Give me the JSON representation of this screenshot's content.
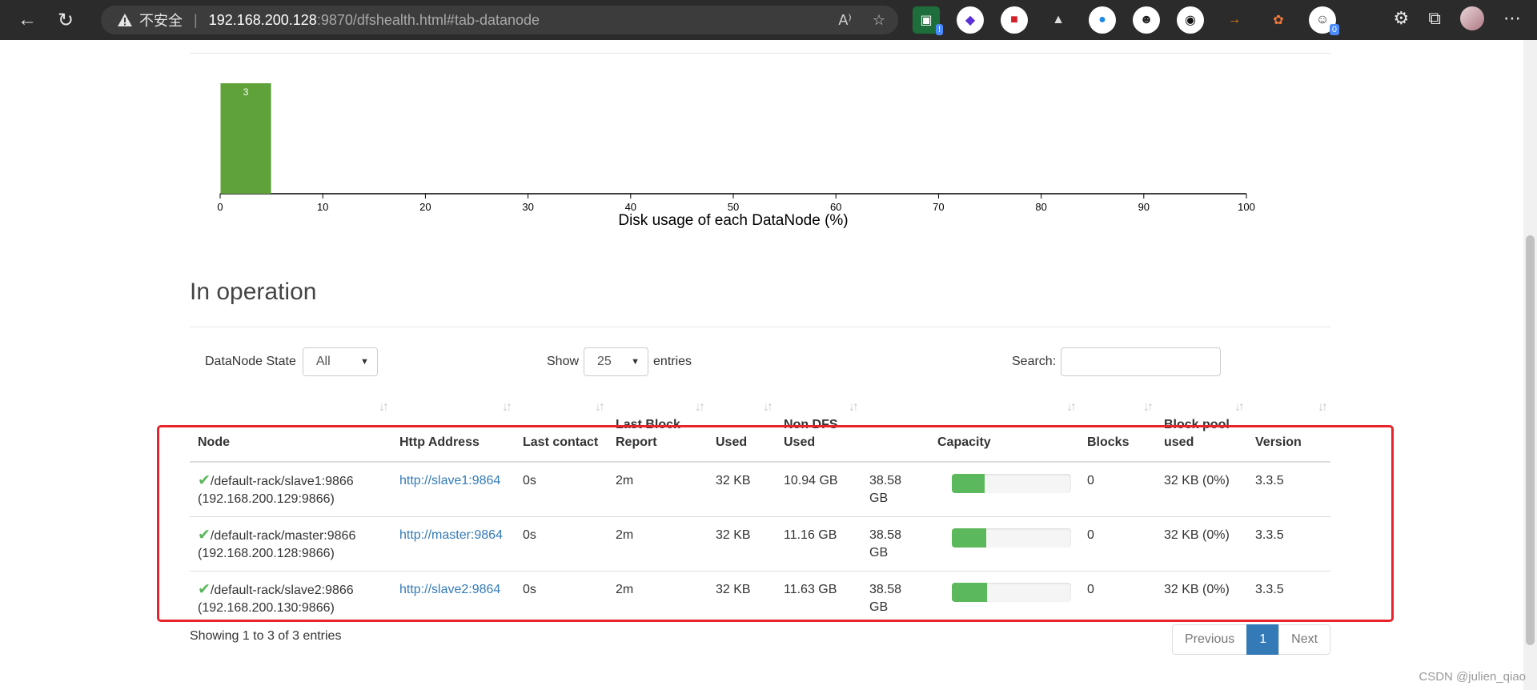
{
  "browser": {
    "insecure_label": "不安全",
    "url_host": "192.168.200.128",
    "url_rest": ":9870/dfshealth.html#tab-datanode",
    "ext_badges": [
      "!",
      "0"
    ]
  },
  "chart_data": {
    "type": "bar",
    "title": "",
    "xlabel": "Disk usage of each DataNode (%)",
    "ylabel": "",
    "bins": [
      {
        "x0": 0,
        "x1": 5,
        "count": 3
      }
    ],
    "xlim": [
      0,
      100
    ],
    "xticks": [
      "0",
      "10",
      "20",
      "30",
      "40",
      "50",
      "60",
      "70",
      "80",
      "90",
      "100"
    ],
    "bar_color": "#5fa23a"
  },
  "section": {
    "title": "In operation"
  },
  "controls": {
    "state_label": "DataNode State",
    "state_value": "All",
    "show_label": "Show",
    "length_value": "25",
    "entries_label": "entries",
    "search_label": "Search:",
    "search_value": ""
  },
  "table": {
    "headers": {
      "node": "Node",
      "http": "Http Address",
      "last_contact": "Last contact",
      "last_block_report": "Last Block Report",
      "used": "Used",
      "non_dfs": "Non DFS Used",
      "capacity": "Capacity",
      "blocks": "Blocks",
      "bp_used": "Block pool used",
      "version": "Version"
    },
    "rows": [
      {
        "node": "/default-rack/slave1:9866",
        "ip": "(192.168.200.129:9866)",
        "http": "http://slave1:9864",
        "last_contact": "0s",
        "last_block_report": "2m",
        "used": "32 KB",
        "non_dfs": "10.94 GB",
        "capacity": "38.58 GB",
        "capacity_fill_percent": 28,
        "blocks": "0",
        "bp_used": "32 KB (0%)",
        "version": "3.3.5"
      },
      {
        "node": "/default-rack/master:9866",
        "ip": "(192.168.200.128:9866)",
        "http": "http://master:9864",
        "last_contact": "0s",
        "last_block_report": "2m",
        "used": "32 KB",
        "non_dfs": "11.16 GB",
        "capacity": "38.58 GB",
        "capacity_fill_percent": 29,
        "blocks": "0",
        "bp_used": "32 KB (0%)",
        "version": "3.3.5"
      },
      {
        "node": "/default-rack/slave2:9866",
        "ip": "(192.168.200.130:9866)",
        "http": "http://slave2:9864",
        "last_contact": "0s",
        "last_block_report": "2m",
        "used": "32 KB",
        "non_dfs": "11.63 GB",
        "capacity": "38.58 GB",
        "capacity_fill_percent": 30,
        "blocks": "0",
        "bp_used": "32 KB (0%)",
        "version": "3.3.5"
      }
    ]
  },
  "footer": {
    "info": "Showing 1 to 3 of 3 entries",
    "prev": "Previous",
    "page": "1",
    "next": "Next"
  },
  "watermark": "CSDN @julien_qiao",
  "colors": {
    "highlight": "#e8242a",
    "link": "#337ab7",
    "success": "#5cb85c"
  }
}
